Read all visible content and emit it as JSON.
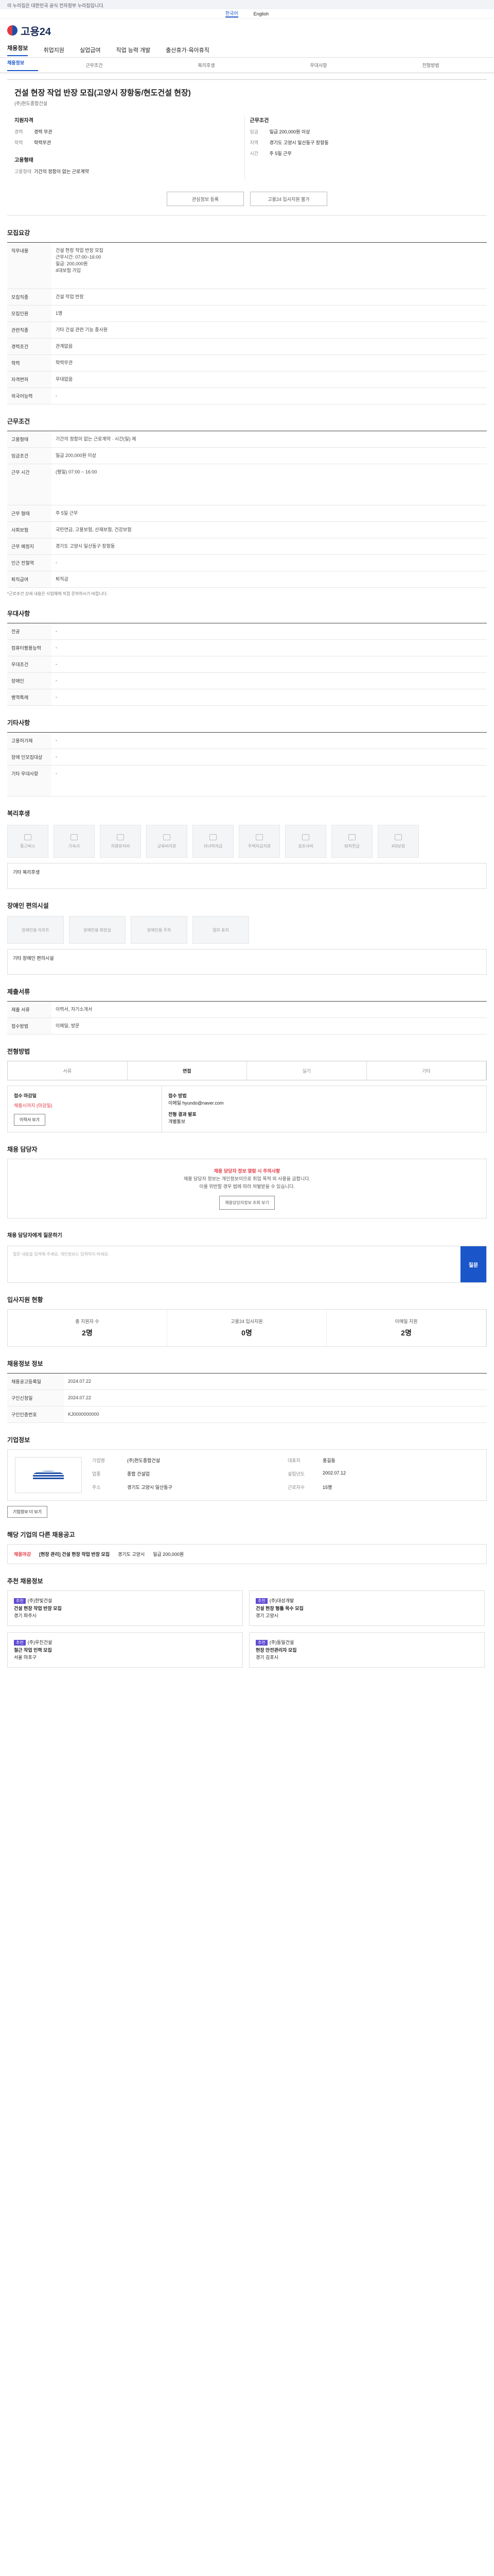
{
  "gov_banner": "이 누리집은 대한민국 공식 전자정부 누리집입니다.",
  "lang": [
    "한국어",
    "English"
  ],
  "site": "고용24",
  "gnb": [
    "채용정보",
    "취업지원",
    "실업급여",
    "직업 능력 개발",
    "출산휴가·육아휴직"
  ],
  "tabs": [
    "채용정보",
    "근무조건",
    "복리후생",
    "우대사항",
    "전형방법"
  ],
  "job": {
    "title": "건설 현장 작업 반장 모집(고양시 장항동/현도건설 현장)",
    "company": "(주)현도종합건설",
    "left_head": "지원자격",
    "career": "경력 무관",
    "edu": "학력무관",
    "right_head": "근무조건",
    "pay": "일급 200,000원 이상",
    "area": "경기도 고양시 일산동구 장항동",
    "time": "주 5일 근무",
    "left_head2": "고용형태",
    "emp": "기간의 정함이 없는 근로계약",
    "btn_interest": "관심정보 등록",
    "btn_apply": "고용24 입사지원 불가"
  },
  "sec_recruit": "모집요강",
  "recruit": [
    [
      "직무내용",
      "건설 현장 작업 반장 모집\n근무시간: 07:00~16:00\n일급: 200,000원\n4대보험 가입"
    ],
    [
      "모집직종",
      "건설 작업 반장"
    ],
    [
      "모집인원",
      "1명"
    ],
    [
      "관련직종",
      "기타 건설 관련 기능 종사원"
    ],
    [
      "경력조건",
      "관계없음"
    ],
    [
      "학력",
      "학력무관"
    ],
    [
      "자격면허",
      "우대없음"
    ],
    [
      "외국어능력",
      "-"
    ]
  ],
  "sec_cond": "근무조건",
  "cond": [
    [
      "고용형태",
      "기간의 정함이 없는 근로계약 · 시간(일) 제"
    ],
    [
      "임금조건",
      "일급 200,000원 이상"
    ],
    [
      "근무 시간",
      "(평일) 07:00 ~ 16:00"
    ],
    [
      "근무 형태",
      "주 5일 근무"
    ],
    [
      "사회보험",
      "국민연금, 고용보험, 산재보험, 건강보험"
    ],
    [
      "근무 예정지",
      "경기도 고양시 일산동구 장항동"
    ],
    [
      "인근 전철역",
      "-"
    ],
    [
      "퇴직급여",
      "퇴직금"
    ]
  ],
  "cond_note": "*근로조건 상세 내용은 사업체에 직접 문의하시기 바랍니다.",
  "sec_pref": "우대사항",
  "pref": [
    [
      "전공",
      "-"
    ],
    [
      "컴퓨터활용능력",
      "-"
    ],
    [
      "우대조건",
      "-"
    ],
    [
      "장애인",
      "-"
    ],
    [
      "병역특례",
      "-"
    ]
  ],
  "sec_etc": "기타사항",
  "etc": [
    [
      "고용허가제",
      "-"
    ],
    [
      "장애 인모집대상",
      "-"
    ],
    [
      "기타 우대사항",
      "-"
    ]
  ],
  "sec_welfare": "복리후생",
  "welfare": [
    "통근버스",
    "기숙사",
    "차량유지비",
    "교육비지원",
    "자녀학자금",
    "주택자금지원",
    "경조사비",
    "퇴직연금",
    "4대보험"
  ],
  "welfare_box": "기타 복리후생",
  "sec_disab": "장애인 편의시설",
  "disab": [
    "장애인용 리프트",
    "장애인용 화장실",
    "장애인용 주차",
    "점자 표지"
  ],
  "disab_box": "기타 장애인 편의시설",
  "sec_cert": "제출서류",
  "cert": [
    [
      "제출 서류",
      "이력서, 자기소개서"
    ],
    [
      "접수방법",
      "이메일, 방문"
    ]
  ],
  "sec_steps": "전형방법",
  "steps": [
    "서류",
    "면접",
    "실기",
    "기타"
  ],
  "apply": {
    "l1": "접수 마감일",
    "l2": "채용시까지 (마감일)",
    "btn": "이력서 보기",
    "r1": "접수 방법",
    "r2": "이메일 hyundo@naver.com",
    "r3": "전형 결과 발표",
    "r4": "개별통보"
  },
  "sec_mgr": "채용 담당자",
  "mgr": {
    "warn": "채용 담당자 정보 열람 시 주의사항",
    "t1": "채용 담당자 정보는 개인정보이므로 취업 목적 외 사용을 금합니다.",
    "t2": "이를 위반할 경우 법에 따라 처벌받을 수 있습니다.",
    "btn": "채용담당자정보 조회 보기"
  },
  "ask": {
    "head": "채용 담당자에게 질문하기",
    "placeholder": "질문 내용을 입력해 주세요. 개인정보는 입력하지 마세요.",
    "submit": "질문"
  },
  "sec_stats": "입사지원 현황",
  "stats": [
    [
      "총 지원자 수",
      "2명"
    ],
    [
      "고용24 입사지원",
      "0명"
    ],
    [
      "이메일 지원",
      "2명"
    ]
  ],
  "sec_reg": "채용정보 정보",
  "reg": [
    [
      "채용공고등록일",
      "2024.07.22"
    ],
    [
      "구인신청일",
      "2024.07.22"
    ],
    [
      "구인인증번호",
      "KJ0000000000"
    ]
  ],
  "sec_corp": "기업정보",
  "corp": [
    [
      "기업명",
      "(주)현도종합건설"
    ],
    [
      "대표자",
      "홍길동"
    ],
    [
      "업종",
      "종합 건설업"
    ],
    [
      "설립년도",
      "2002.07.12"
    ],
    [
      "주소",
      "경기도 고양시 일산동구"
    ],
    [
      "근로자수",
      "15명"
    ]
  ],
  "corp_btn": "기업정보 더 보기",
  "sec_other": "해당 기업의 다른 채용공고",
  "other": {
    "tag": "채용마감",
    "title": "[현장 관리] 건설 현장 작업 반장 모집",
    "loc": "경기도 고양시",
    "pay": "일급 200,000원"
  },
  "sec_rec": "추천 채용정보",
  "rec": [
    {
      "tag": "추천",
      "title": "건설 현장 작업 반장 모집",
      "co": "(주)한빛건설",
      "loc": "경기 파주시"
    },
    {
      "tag": "추천",
      "title": "건설 현장 형틀 목수 모집",
      "co": "(주)대성개발",
      "loc": "경기 고양시"
    },
    {
      "tag": "추천",
      "title": "철근 작업 인력 모집",
      "co": "(주)우진건설",
      "loc": "서울 마포구"
    },
    {
      "tag": "추천",
      "title": "현장 안전관리자 모집",
      "co": "(주)동일건설",
      "loc": "경기 김포시"
    }
  ]
}
